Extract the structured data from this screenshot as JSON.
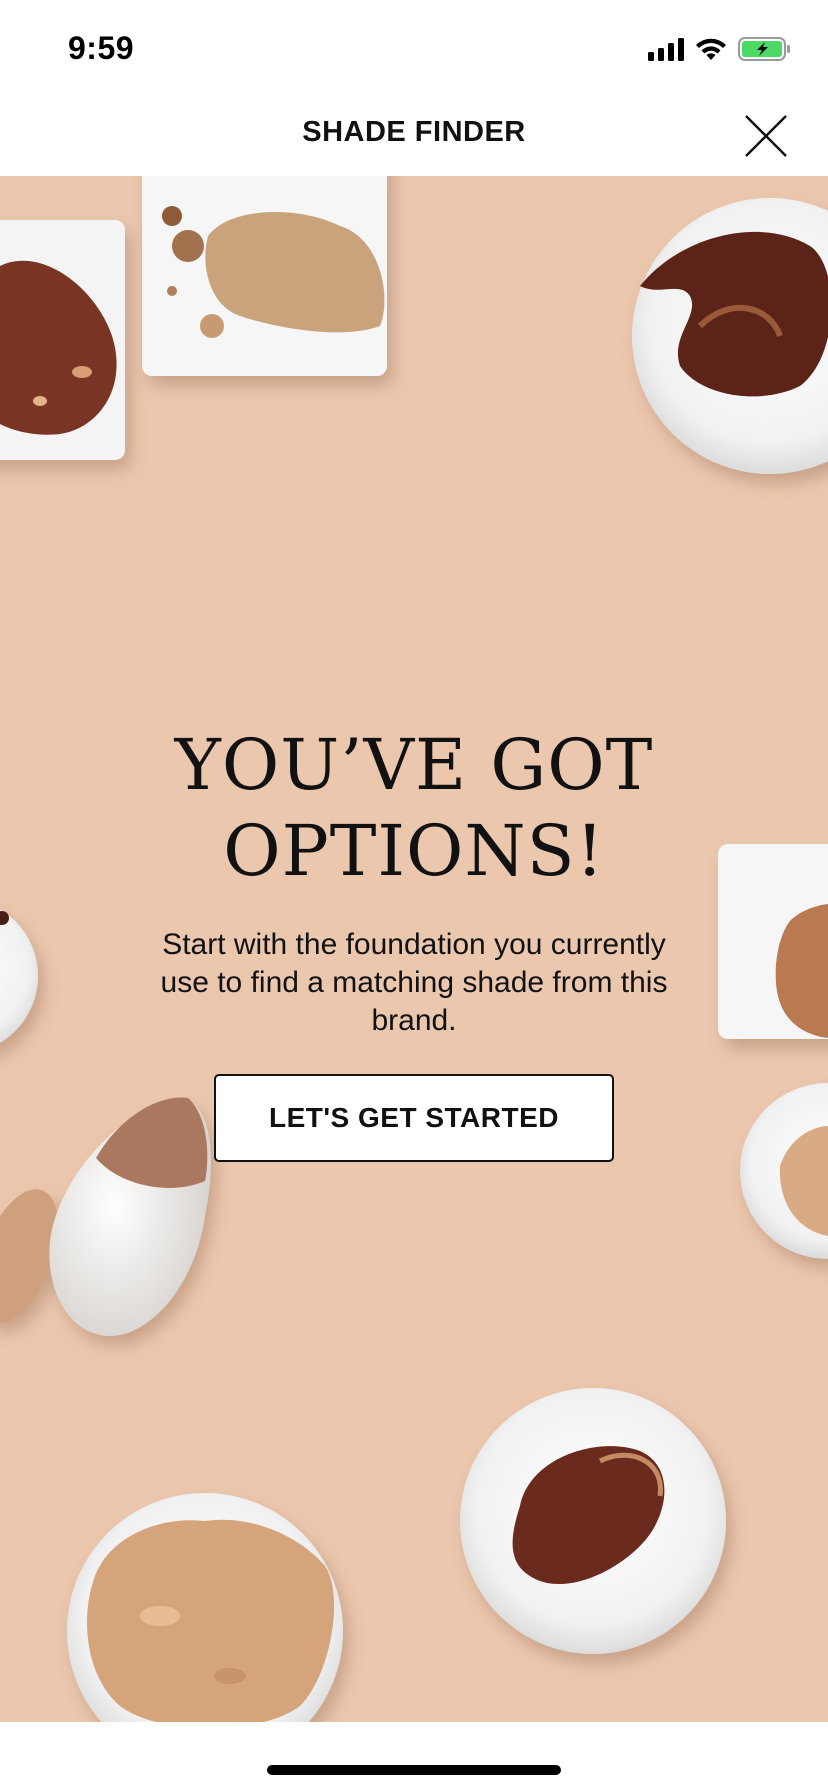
{
  "status_bar": {
    "time": "9:59",
    "icons": [
      "cellular-signal-icon",
      "wifi-icon",
      "battery-charging-icon"
    ],
    "battery_color": "#4cd964"
  },
  "header": {
    "title": "SHADE FINDER",
    "close_icon": "close-icon"
  },
  "hero": {
    "background_color": "#ebc7ae",
    "heading_line1": "YOU’VE GOT",
    "heading_line2": "OPTIONS!",
    "subtitle": "Start with the foundation you currently use to find a matching shade from this brand.",
    "cta_label": "LET'S GET STARTED"
  }
}
